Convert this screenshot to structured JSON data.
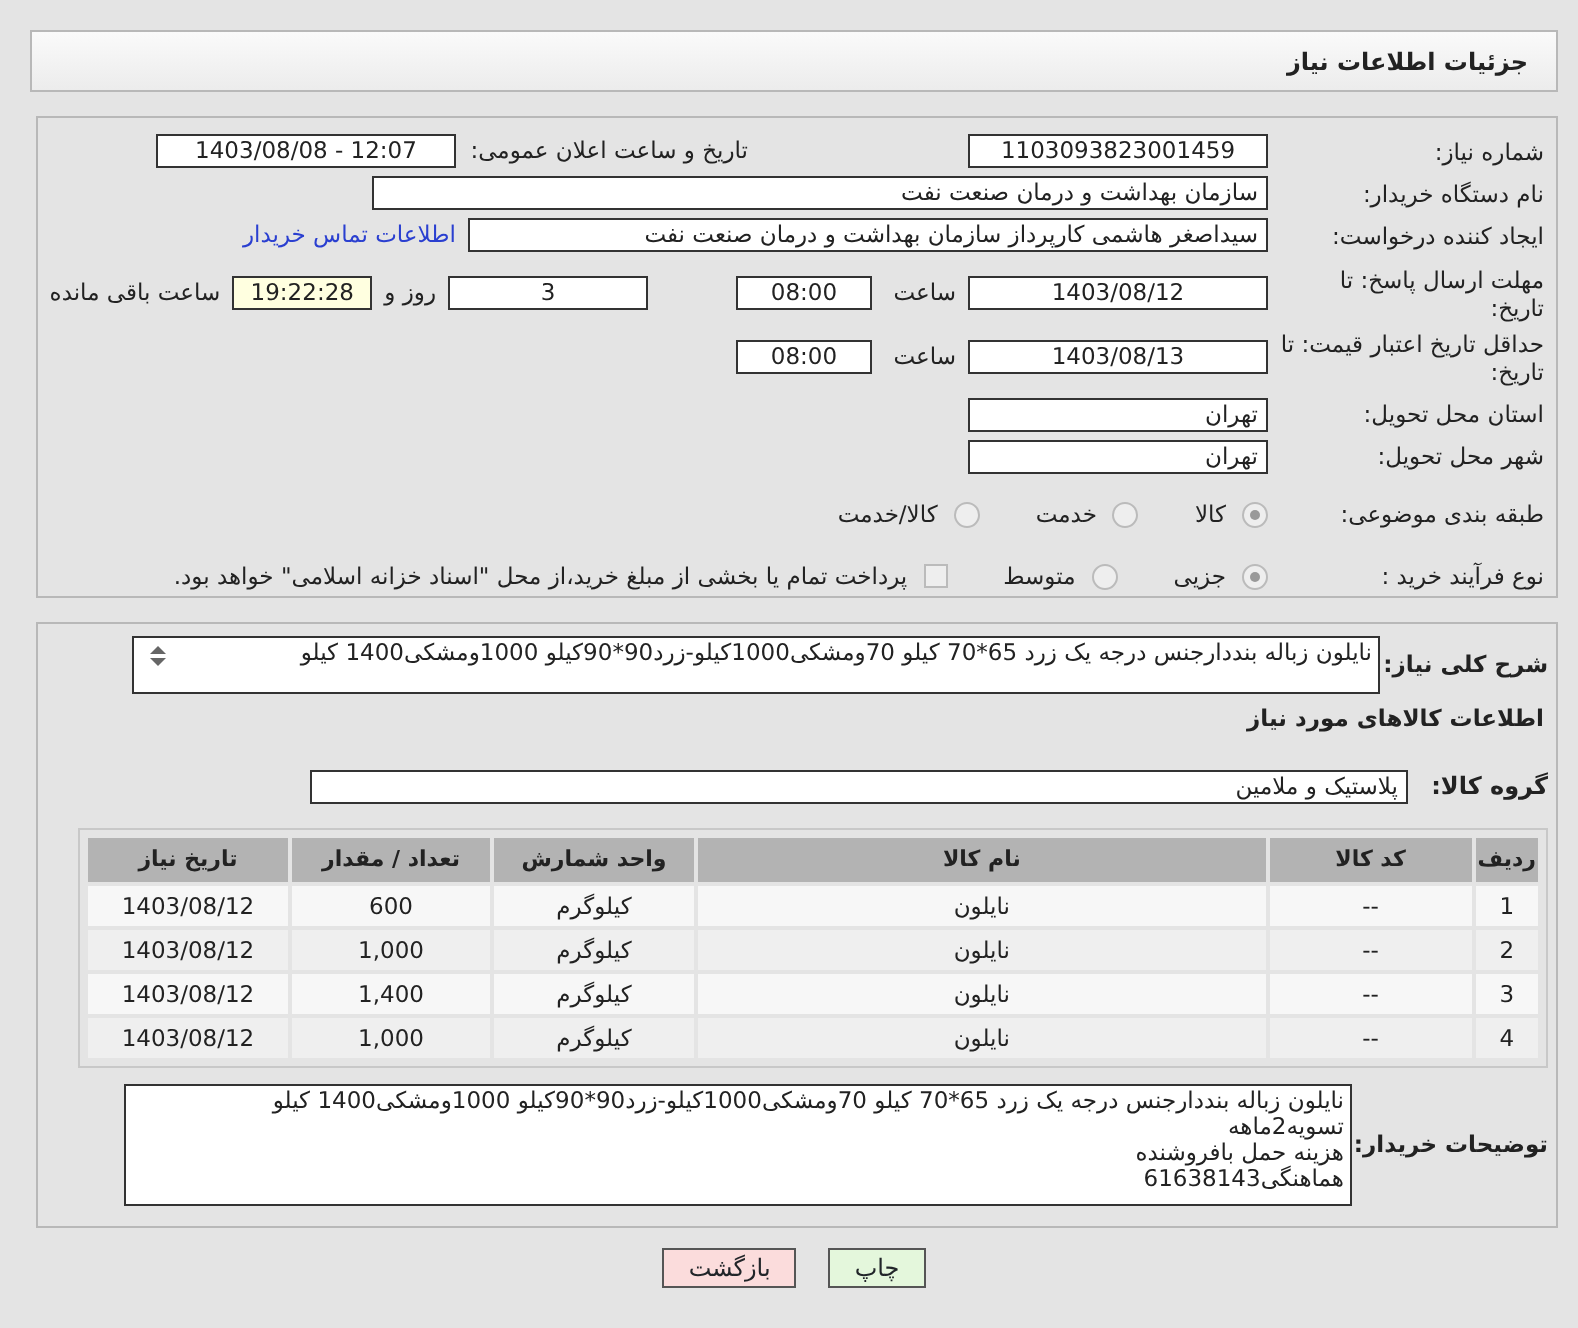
{
  "header": {
    "title": "جزئیات اطلاعات نیاز"
  },
  "need_number": {
    "label": "شماره نیاز:",
    "value": "1103093823001459"
  },
  "announce": {
    "label": "تاریخ و ساعت اعلان عمومی:",
    "value": "1403/08/08 - 12:07"
  },
  "buyer_org": {
    "label": "نام دستگاه خریدار:",
    "value": "سازمان بهداشت و درمان صنعت نفت"
  },
  "creator": {
    "label": "ایجاد کننده درخواست:",
    "value": "سیداصغر هاشمی کارپرداز سازمان بهداشت و درمان صنعت نفت",
    "link": "اطلاعات تماس خریدار"
  },
  "deadline": {
    "label": "مهلت ارسال پاسخ: تا تاریخ:",
    "date": "1403/08/12",
    "time_label": "ساعت",
    "time": "08:00",
    "days": "3",
    "days_label": "روز و",
    "remaining": "19:22:28",
    "remaining_label": "ساعت باقی مانده"
  },
  "validity": {
    "label": "حداقل تاریخ اعتبار قیمت: تا تاریخ:",
    "date": "1403/08/13",
    "time_label": "ساعت",
    "time": "08:00"
  },
  "province": {
    "label": "استان محل تحویل:",
    "value": "تهران"
  },
  "city": {
    "label": "شهر محل تحویل:",
    "value": "تهران"
  },
  "category": {
    "label": "طبقه بندی موضوعی:",
    "options": [
      {
        "label": "کالا",
        "selected": true
      },
      {
        "label": "خدمت",
        "selected": false
      },
      {
        "label": "کالا/خدمت",
        "selected": false
      }
    ]
  },
  "process": {
    "label": "نوع فرآیند خرید :",
    "options": [
      {
        "label": "جزیی",
        "selected": true
      },
      {
        "label": "متوسط",
        "selected": false
      }
    ],
    "payment": {
      "label": "پرداخت تمام یا بخشی از مبلغ خرید،از محل \"اسناد خزانه اسلامی\" خواهد بود.",
      "checked": false
    }
  },
  "summary": {
    "label": "شرح کلی نیاز:",
    "value": "نایلون زباله بنددارجنس درجه یک زرد 65*70 کیلو 70ومشکی1000کیلو-زرد90*90کیلو 1000ومشکی1400 کیلو"
  },
  "goods": {
    "title": "اطلاعات کالاهای مورد نیاز",
    "group_label": "گروه کالا:",
    "group": "پلاستیک و ملامین"
  },
  "table": {
    "columns": [
      "ردیف",
      "کد کالا",
      "نام کالا",
      "واحد شمارش",
      "تعداد / مقدار",
      "تاریخ نیاز"
    ],
    "rows": [
      [
        "1",
        "--",
        "نایلون",
        "کیلوگرم",
        "600",
        "1403/08/12"
      ],
      [
        "2",
        "--",
        "نایلون",
        "کیلوگرم",
        "1,000",
        "1403/08/12"
      ],
      [
        "3",
        "--",
        "نایلون",
        "کیلوگرم",
        "1,400",
        "1403/08/12"
      ],
      [
        "4",
        "--",
        "نایلون",
        "کیلوگرم",
        "1,000",
        "1403/08/12"
      ]
    ]
  },
  "buyer_notes": {
    "label": "توضیحات خریدار:",
    "lines": [
      "نایلون زباله بنددارجنس درجه یک زرد 65*70 کیلو 70ومشکی1000کیلو-زرد90*90کیلو 1000ومشکی1400 کیلو",
      "تسویه2ماهه",
      "هزینه حمل بافروشنده",
      "هماهنگی61638143"
    ]
  },
  "buttons": [
    {
      "label": "چاپ",
      "kind": "print"
    },
    {
      "label": "بازگشت",
      "kind": "back"
    }
  ]
}
